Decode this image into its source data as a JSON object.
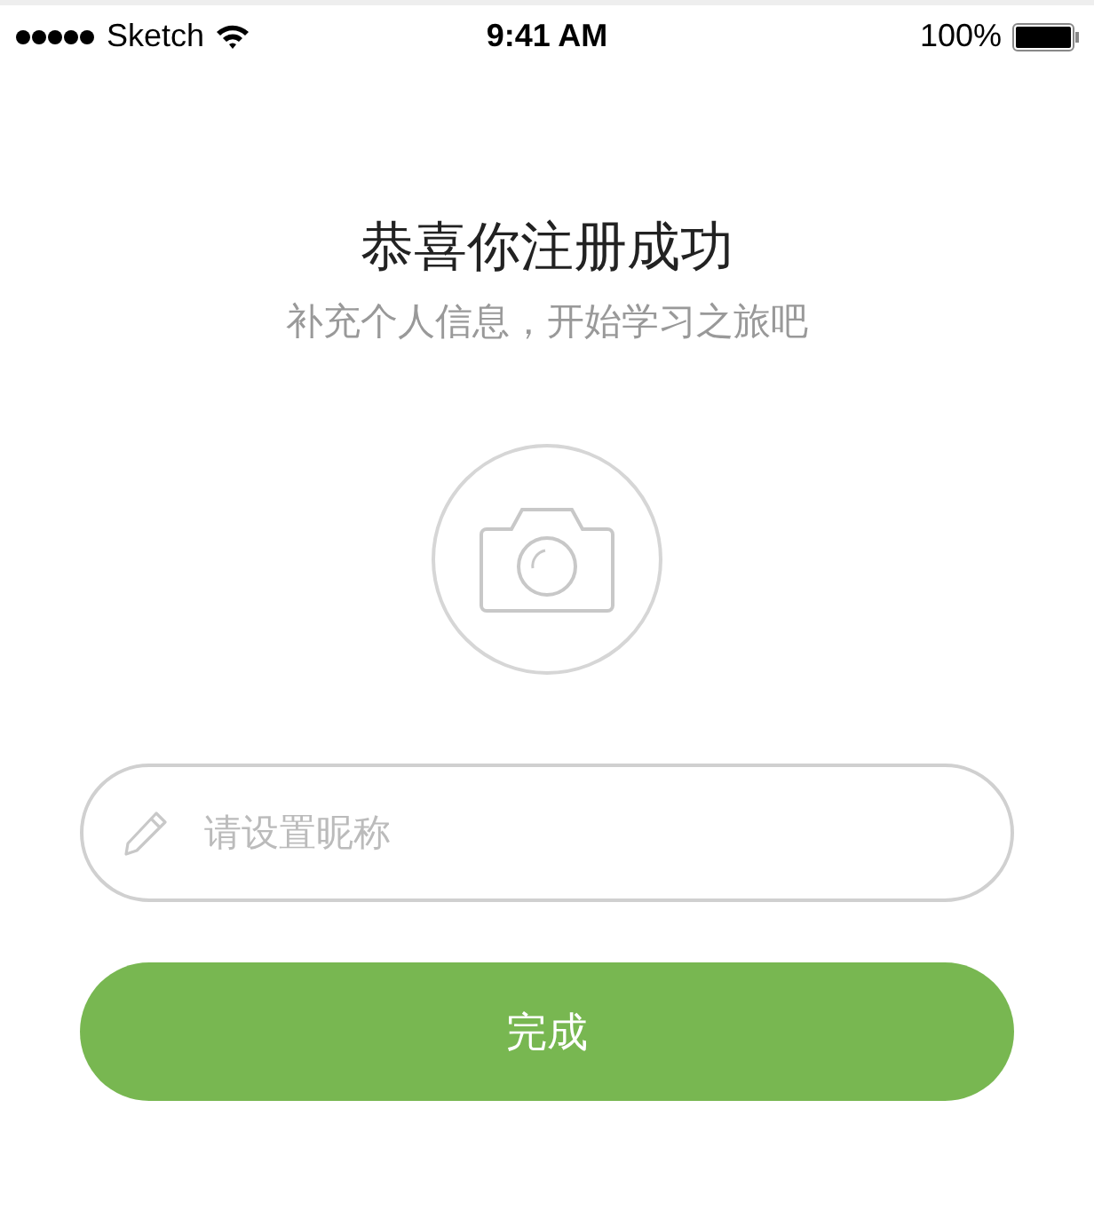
{
  "status_bar": {
    "carrier": "Sketch",
    "time": "9:41 AM",
    "battery": "100%"
  },
  "title": "恭喜你注册成功",
  "subtitle": "补充个人信息，开始学习之旅吧",
  "nickname_field": {
    "placeholder": "请设置昵称"
  },
  "submit_button": {
    "label": "完成"
  }
}
